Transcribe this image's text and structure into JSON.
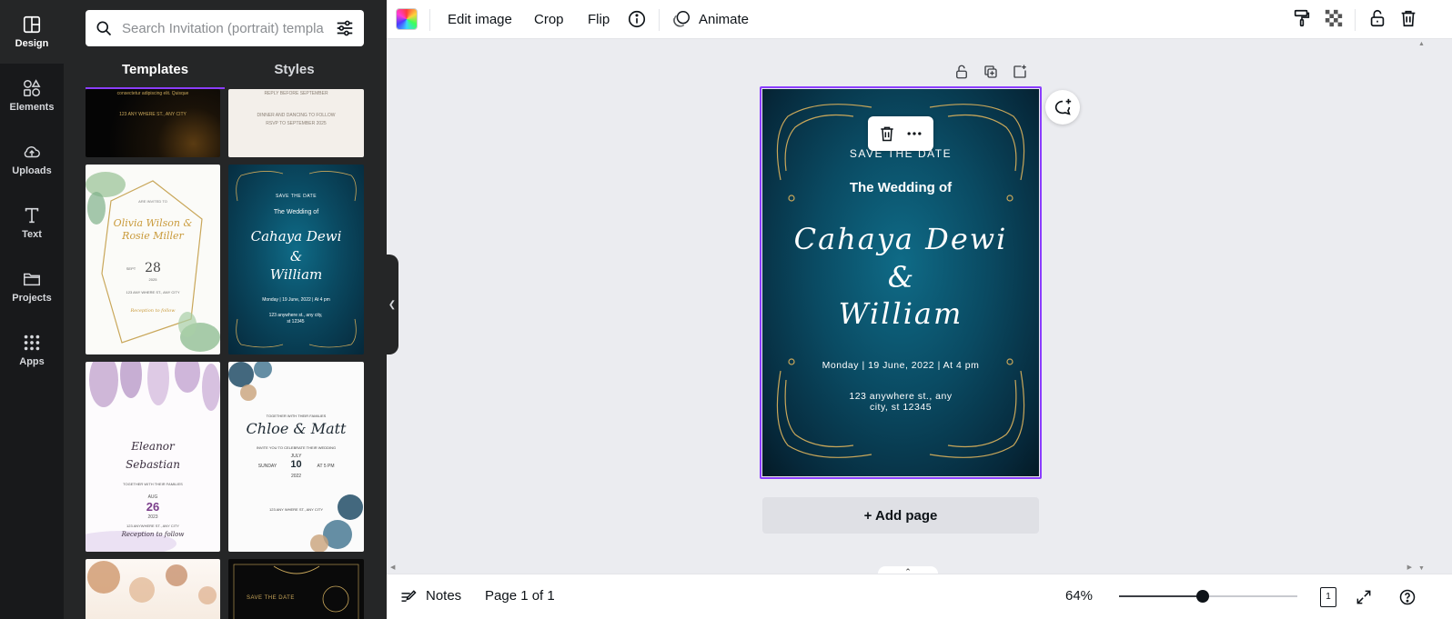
{
  "rail": {
    "items": [
      {
        "label": "Design",
        "icon": "layout-icon"
      },
      {
        "label": "Elements",
        "icon": "shapes-icon"
      },
      {
        "label": "Uploads",
        "icon": "cloud-upload-icon"
      },
      {
        "label": "Text",
        "icon": "text-t-icon"
      },
      {
        "label": "Projects",
        "icon": "folder-icon"
      },
      {
        "label": "Apps",
        "icon": "grid-icon"
      }
    ]
  },
  "panel": {
    "search_placeholder": "Search Invitation (portrait) templa",
    "tabs": [
      "Templates",
      "Styles"
    ],
    "thumbs": {
      "t1": {
        "line1": "consectetur adipiscing elit. Quisque",
        "line2": "123 ANY WHERE ST., ANY CITY"
      },
      "t2": {
        "line1": "REPLY BEFORE SEPTEMBER",
        "line2": "DINNER AND DANCING TO FOLLOW",
        "line3": "RSVP TO SEPTEMBER 2025"
      },
      "t3": {
        "top": "ARE INVITED TO",
        "names": "Olivia Wilson & Rosie Miller",
        "month": "SEPT",
        "day": "28",
        "year": "2025",
        "place": "123 ANY WHERE ST., ANY CITY",
        "footer": "Reception to follow"
      },
      "t4": {
        "save": "SAVE THE DATE",
        "wedding": "The Wedding of",
        "name1": "Cahaya Dewi",
        "amp": "&",
        "name2": "William",
        "date": "Monday | 19 June, 2022 | At 4 pm",
        "addr": "123 anywhere st., any city, st 12345"
      },
      "t5": {
        "name1": "Eleanor",
        "name2": "Sebastian",
        "invite": "TOGETHER WITH THEIR FAMILIES",
        "month": "AUG",
        "day": "26",
        "year": "2023",
        "place": "123 ANYWHERE ST., ANY CITY",
        "footer": "Reception to follow"
      },
      "t6": {
        "top": "TOGETHER WITH THEIR FAMILIES",
        "names": "Chloe & Matt",
        "invite": "INVITE YOU TO CELEBRATE THEIR WEDDING",
        "month": "JULY",
        "day_name": "SUNDAY",
        "day": "10",
        "time": "AT 5 PM",
        "year": "2022",
        "place": "123 ANY WHERE ST., ANY CITY"
      },
      "t8": {
        "save": "SAVE THE DATE"
      }
    }
  },
  "toolbar": {
    "edit_image": "Edit image",
    "crop": "Crop",
    "flip": "Flip",
    "animate": "Animate"
  },
  "canvas": {
    "save_the_date": "SAVE THE DATE",
    "wedding_of": "The Wedding of",
    "name1": "Cahaya Dewi",
    "ampersand": "&",
    "name2": "William",
    "date": "Monday | 19 June, 2022 | At 4 pm",
    "address_line1": "123 anywhere st., any",
    "address_line2": "city, st 12345",
    "add_page": "+ Add page"
  },
  "bottom": {
    "notes": "Notes",
    "page_indicator": "Page 1 of 1",
    "zoom": "64%",
    "zoom_slider_fraction": 0.47,
    "page_count_badge": "1"
  },
  "colors": {
    "accent": "#8b3dff",
    "rail_bg": "#18191b",
    "panel_bg": "#252627",
    "canvas_bg": "#ebecf0",
    "invite_teal": "#0a4a62",
    "gold": "#c9a75a"
  }
}
